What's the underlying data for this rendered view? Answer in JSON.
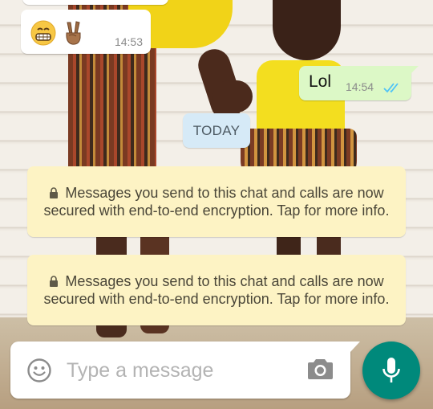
{
  "chat": {
    "messages": [
      {
        "direction": "incoming",
        "content": "😁✌🏽",
        "emoji_icons": [
          "grinning-face-icon",
          "victory-hand-icon"
        ],
        "time": "14:53"
      },
      {
        "direction": "outgoing",
        "text": "Lol",
        "time": "14:54",
        "status_icon": "double-check-read-icon"
      }
    ],
    "date_separator": "TODAY",
    "system_notices": [
      {
        "icon": "lock-icon",
        "text": "Messages you send to this chat and calls are now secured with end-to-end encryption. Tap for more info."
      },
      {
        "icon": "lock-icon",
        "text": "Messages you send to this chat and calls are now secured with end-to-end encryption. Tap for more info."
      }
    ]
  },
  "composer": {
    "placeholder": "Type a message",
    "value": "",
    "icons": {
      "emoji": "smiley-icon",
      "camera": "camera-icon",
      "send": "microphone-icon"
    }
  },
  "colors": {
    "outgoing_bubble": "#dcf8c6",
    "incoming_bubble": "#ffffff",
    "date_pill": "#d6eaf7",
    "notice_bubble": "#fdf3c4",
    "read_ticks": "#4fc3f7",
    "mic_button": "#00897b"
  }
}
